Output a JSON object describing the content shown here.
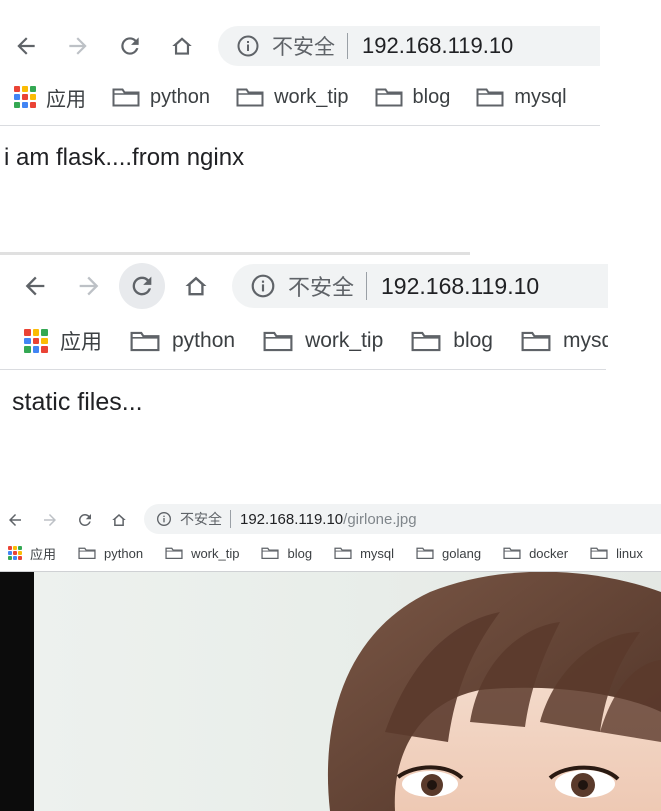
{
  "shots": [
    {
      "address": {
        "insecure_label": "不安全",
        "host": "192.168.119.10",
        "path": ""
      },
      "bookmarks": [
        "应用",
        "python",
        "work_tip",
        "blog",
        "mysql"
      ],
      "page_text": "i am flask....from nginx"
    },
    {
      "address": {
        "insecure_label": "不安全",
        "host": "192.168.119.10",
        "path": ""
      },
      "bookmarks": [
        "应用",
        "python",
        "work_tip",
        "blog",
        "mysql"
      ],
      "page_text": "static files..."
    },
    {
      "address": {
        "insecure_label": "不安全",
        "host": "192.168.119.10",
        "path": "/girlone.jpg"
      },
      "bookmarks": [
        "应用",
        "python",
        "work_tip",
        "blog",
        "mysql",
        "golang",
        "docker",
        "linux"
      ],
      "page_text": ""
    }
  ],
  "icons": {
    "back": "arrow-left-icon",
    "forward": "arrow-right-icon",
    "reload": "reload-icon",
    "home": "home-icon",
    "info": "info-circle-icon",
    "apps": "apps-grid-icon",
    "folder": "folder-icon"
  },
  "colors": {
    "omnibox_bg": "#f1f3f4",
    "icon_gray": "#5f6368",
    "forward_disabled": "#bdc1c6",
    "path_gray": "#80868b",
    "hair": "#6b4a3a"
  }
}
